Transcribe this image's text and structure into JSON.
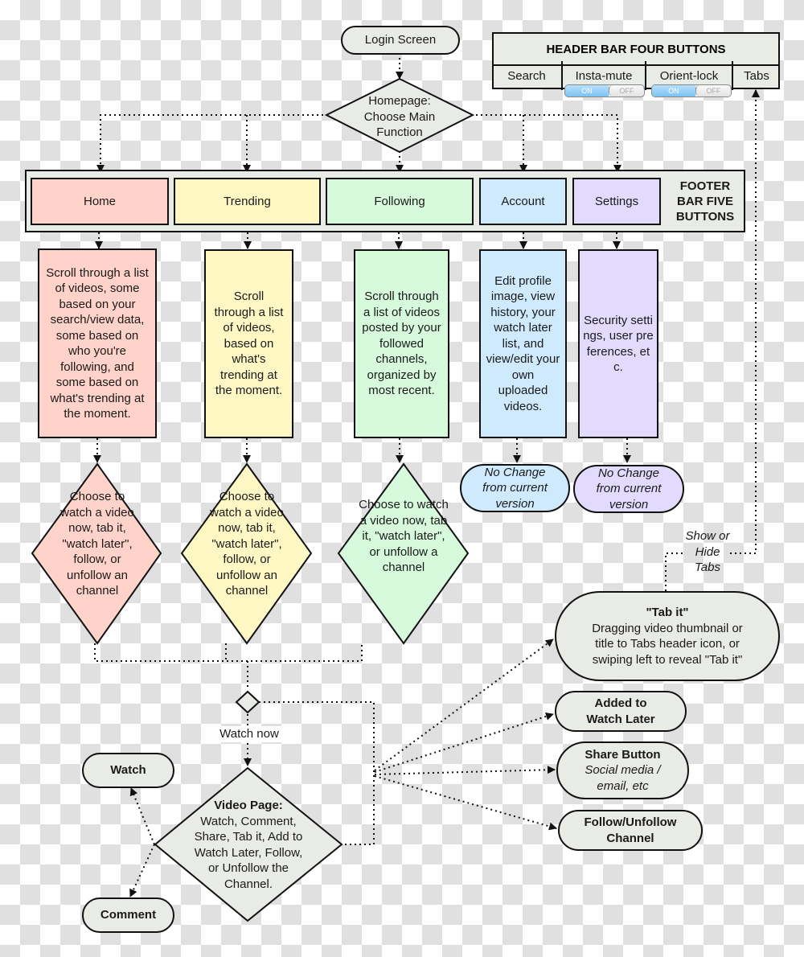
{
  "colors": {
    "home": "#ffd3c9",
    "trending": "#fff8c4",
    "following": "#d7f9dc",
    "account": "#cfeafd",
    "settings": "#e2dbfd",
    "neutral": "#e9ebe6",
    "stroke": "#111111",
    "toggle_on": "#7cc3f3"
  },
  "start": {
    "label": "Login Screen"
  },
  "homepage": {
    "label": "Homepage: Choose Main Function"
  },
  "header_bar": {
    "title": "HEADER BAR FOUR BUTTONS",
    "buttons": [
      {
        "label": "Search"
      },
      {
        "label": "Insta-mute",
        "toggle": {
          "on": "ON",
          "off": "OFF",
          "state": "ON"
        }
      },
      {
        "label": "Orient-lock",
        "toggle": {
          "on": "ON",
          "off": "OFF",
          "state": "ON"
        }
      },
      {
        "label": "Tabs"
      }
    ]
  },
  "footer_bar": {
    "title": "FOOTER BAR FIVE BUTTONS",
    "buttons": [
      {
        "label": "Home"
      },
      {
        "label": "Trending"
      },
      {
        "label": "Following"
      },
      {
        "label": "Account"
      },
      {
        "label": "Settings"
      }
    ]
  },
  "descriptions": [
    "Scroll through a list of videos, some based on your search/view data, some based on who you're following, and some based on what's trending at the moment.",
    "Scroll through a list of videos, based on what's trending at the moment.",
    "Scroll through a list of videos posted by your followed channels, organized by most recent.",
    "Edit profile image, view history, your watch later list, and view/edit your own uploaded videos.",
    "Security settings, user preferences, etc."
  ],
  "decisions": [
    "Choose to watch a video now, tab it, \"watch later\", follow, or unfollow an channel",
    "Choose to watch a video now, tab it, \"watch later\", follow, or unfollow an channel",
    "Choose to watch a video now, tab it, \"watch later\", or unfollow a channel"
  ],
  "no_change": [
    "No Change from current version",
    "No Change from current version"
  ],
  "show_hide_label": "Show or Hide Tabs",
  "watch_now_label": "Watch now",
  "video_page": {
    "title": "Video Page:",
    "body": "Watch, Comment, Share, Tab it, Add to Watch Later, Follow, or Unfollow the Channel."
  },
  "outcomes": {
    "watch": "Watch",
    "comment": "Comment",
    "tab_it": {
      "title": "\"Tab it\"",
      "body": "Dragging video thumbnail or title to Tabs header icon, or swiping left to reveal \"Tab it\""
    },
    "watch_later": "Added to Watch Later",
    "share": {
      "title": "Share Button",
      "body": "Social media / email, etc"
    },
    "follow": "Follow/Unfollow Channel"
  }
}
